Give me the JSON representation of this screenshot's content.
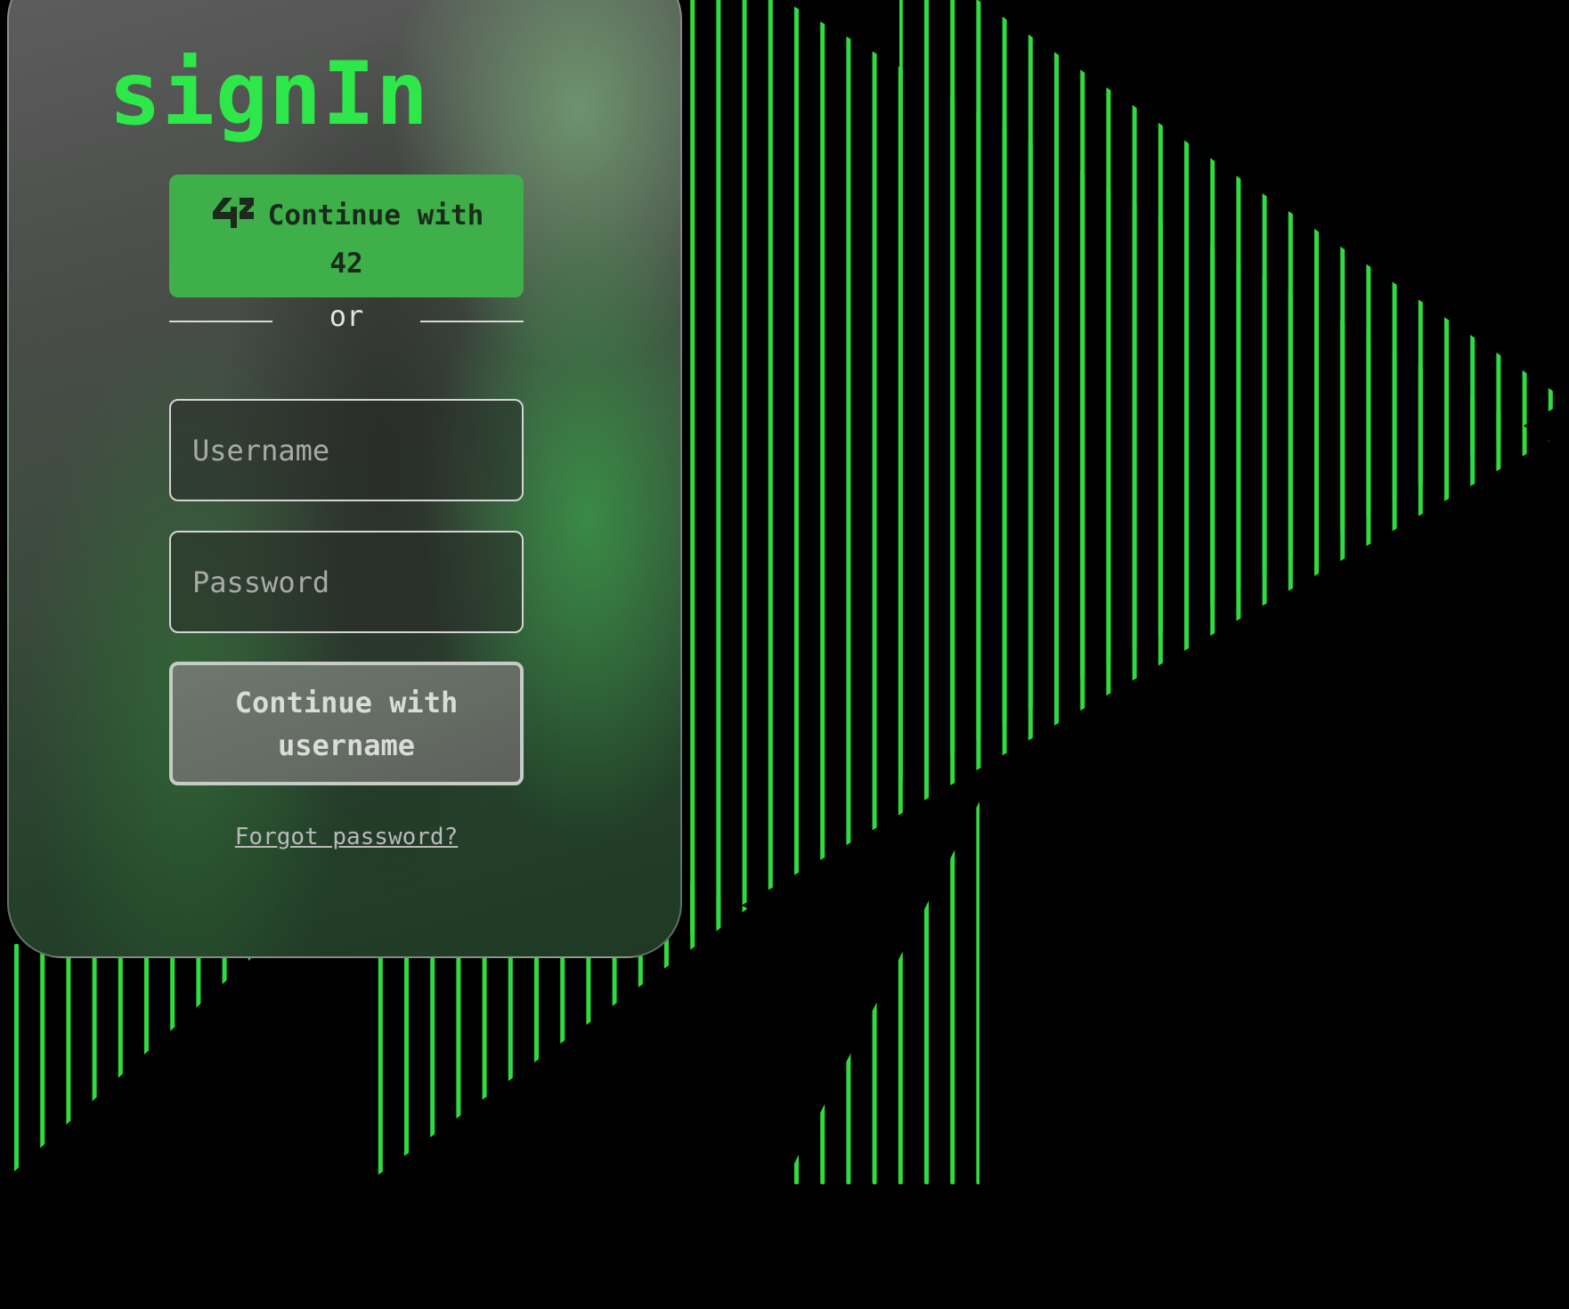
{
  "auth": {
    "title": "signIn",
    "oauth_button_label": "Continue with 42",
    "oauth_provider_logo": "42",
    "divider_text": "or",
    "username_placeholder": "Username",
    "username_value": "",
    "password_placeholder": "Password",
    "password_value": "",
    "submit_label": "Continue with username",
    "forgot_link": "Forgot password?"
  },
  "icons": {
    "oauth_logo": "42-school-logo-icon"
  },
  "colors": {
    "background": "#000000",
    "accent_green": "#2ee84a",
    "oauth_button_bg": "#3faf49",
    "stripe_green": "#2fdc3f"
  }
}
